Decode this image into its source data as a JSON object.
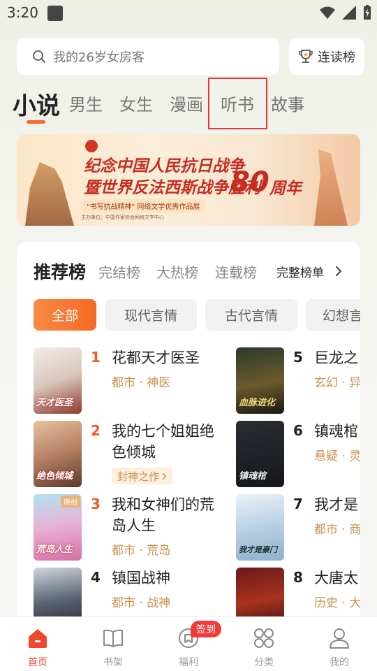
{
  "status_bar": {
    "time": "3:20"
  },
  "search": {
    "placeholder": "我的26岁女房客"
  },
  "rank_button": {
    "label": "连读榜"
  },
  "top_tabs": [
    {
      "label": "小说",
      "active": true
    },
    {
      "label": "男生"
    },
    {
      "label": "女生"
    },
    {
      "label": "漫画"
    },
    {
      "label": "听书"
    },
    {
      "label": "故事"
    }
  ],
  "banner": {
    "line1": "纪念中国人民抗日战争",
    "line2": "暨世界反法西斯战争胜利",
    "number": "80",
    "suffix": "周年",
    "subtitle": "\"书写抗战精神\" 网络文学优秀作品展",
    "footer": "主办单位：中国作家协会网络文学中心"
  },
  "rank_tabs": [
    {
      "label": "推荐榜",
      "active": true
    },
    {
      "label": "完结榜"
    },
    {
      "label": "大热榜"
    },
    {
      "label": "连载榜"
    }
  ],
  "full_rank_label": "完整榜单",
  "filter_chips": [
    {
      "label": "全部",
      "active": true
    },
    {
      "label": "现代言情"
    },
    {
      "label": "古代言情"
    },
    {
      "label": "幻想言"
    }
  ],
  "books_left": [
    {
      "rank": "1",
      "title": "花都天才医圣",
      "tags": "都市 · 神医",
      "cover_text": "天才医圣"
    },
    {
      "rank": "2",
      "title": "我的七个姐姐绝色倾城",
      "award": "封神之作",
      "cover_text": "绝色倾城"
    },
    {
      "rank": "3",
      "title": "我和女神们的荒岛人生",
      "tags": "都市 · 荒岛",
      "cover_text": "荒岛人生",
      "badge": "原创"
    },
    {
      "rank": "4",
      "title": "镇国战神",
      "tags": "都市 · 战神"
    }
  ],
  "books_right": [
    {
      "rank": "5",
      "title": "巨龙之",
      "tags": "玄幻 · 异",
      "cover_text": "血脉进化"
    },
    {
      "rank": "6",
      "title": "镇魂棺",
      "tags": "悬疑 · 灵",
      "cover_text": "镇魂棺"
    },
    {
      "rank": "7",
      "title": "我才是",
      "tags": "都市 · 商",
      "cover_text": "我才是豪门"
    },
    {
      "rank": "8",
      "title": "大唐太",
      "tags": "历史 · 大"
    }
  ],
  "bottom_nav": [
    {
      "label": "首页",
      "icon": "home-icon",
      "active": true
    },
    {
      "label": "书架",
      "icon": "book-icon"
    },
    {
      "label": "福利",
      "icon": "gift-icon"
    },
    {
      "label": "分类",
      "icon": "category-icon"
    },
    {
      "label": "我的",
      "icon": "user-icon"
    }
  ],
  "sign_in_badge": "签到",
  "colors": {
    "accent": "#f56a24",
    "tag": "#c8924f",
    "nav_active": "#f0472f",
    "highlight_box": "#e2393a"
  }
}
